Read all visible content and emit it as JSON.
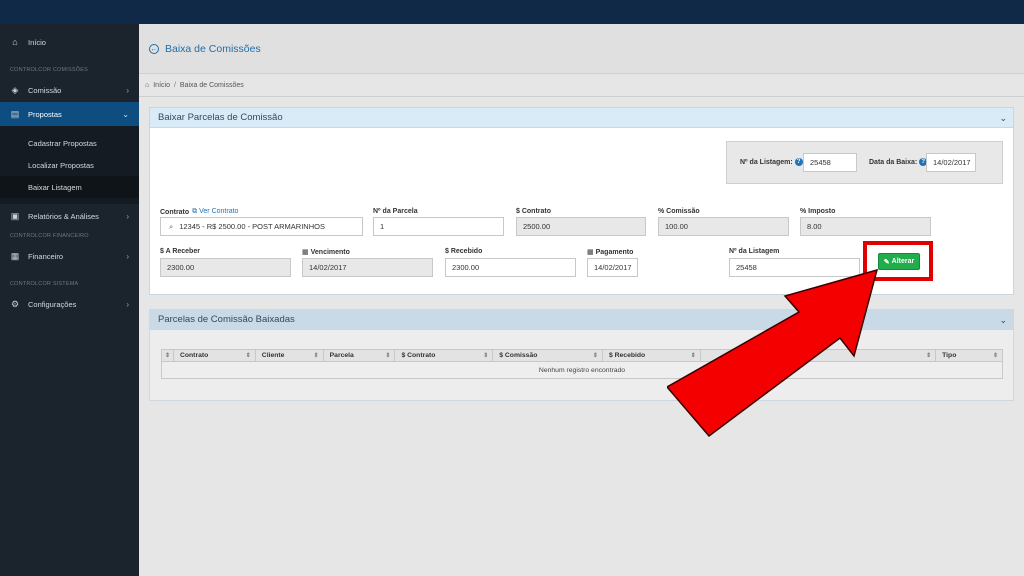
{
  "sidebar": {
    "inicio": "Início",
    "section_comissoes": "CONTROLCOR COMISSÕES",
    "comissao": "Comissão",
    "propostas": "Propostas",
    "sub": [
      "Cadastrar Propostas",
      "Localizar Propostas",
      "Baixar Listagem"
    ],
    "relatorios": "Relatórios & Análises",
    "section_financeiro": "CONTROLCOR FINANCEIRO",
    "financeiro": "Financeiro",
    "section_sistema": "CONTROLCOR SISTEMA",
    "configuracoes": "Configurações"
  },
  "header": {
    "title": "Baixa de Comissões",
    "breadcrumb": [
      "Início",
      "Baixa de Comissões"
    ]
  },
  "panel1": {
    "title": "Baixar Parcelas de Comissão",
    "listagem_label": "Nº da Listagem:",
    "listagem_value": "25458",
    "data_baixa_label": "Data da Baixa:",
    "data_baixa_value": "14/02/2017",
    "contrato_label": "Contrato",
    "ver_contrato": "Ver Contrato",
    "contrato_value": "12345 - R$ 2500.00 - POST ARMARINHOS",
    "parcela_label": "Nº da Parcela",
    "parcela_value": "1",
    "valor_contrato_label": "$ Contrato",
    "valor_contrato_value": "2500.00",
    "pct_comissao_label": "% Comissão",
    "pct_comissao_value": "100.00",
    "pct_imposto_label": "% Imposto",
    "pct_imposto_value": "8.00",
    "a_receber_label": "$ A Receber",
    "a_receber_value": "2300.00",
    "vencimento_label": "Vencimento",
    "vencimento_value": "14/02/2017",
    "recebido_label": "$ Recebido",
    "recebido_value": "2300.00",
    "pagamento_label": "Pagamento",
    "pagamento_value": "14/02/2017",
    "listagem2_label": "Nº da Listagem",
    "listagem2_value": "25458",
    "alterar_button": "Alterar"
  },
  "panel2": {
    "title": "Parcelas de Comissão Baixadas",
    "columns": [
      "Contrato",
      "Cliente",
      "Parcela",
      "$ Contrato",
      "$ Comissão",
      "$ Recebido",
      "Tipo"
    ],
    "empty": "Nenhum registro encontrado"
  },
  "colors": {
    "topbar": "#0f2947",
    "sidebar": "#1b232c",
    "active": "#0d4d80",
    "primary": "#1f73b7",
    "success": "#1fae4b",
    "highlight": "#e10000"
  }
}
